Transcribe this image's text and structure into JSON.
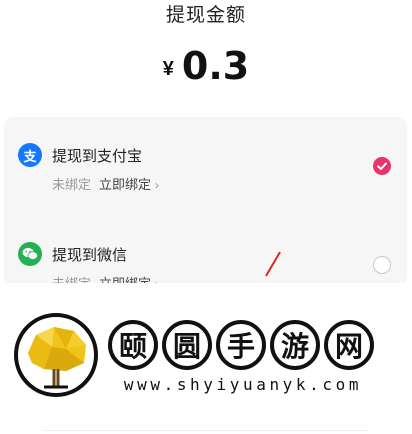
{
  "header": {
    "title": "提现金额"
  },
  "amount": {
    "currency": "¥",
    "value": "0.3"
  },
  "options": [
    {
      "name": "提现到支付宝",
      "status": "未绑定",
      "action": "立即绑定",
      "arrow": "›",
      "selected": true,
      "icon": "alipay-icon",
      "icon_color": "#1677ff",
      "icon_glyph": "支"
    },
    {
      "name": "提现到微信",
      "status": "未绑定",
      "action": "立即绑定",
      "arrow": "›",
      "selected": false,
      "icon": "wechat-icon",
      "icon_color": "#22b153"
    }
  ],
  "accent_color": "#e8336d",
  "watermark": {
    "chars": [
      "颐",
      "圆",
      "手",
      "游",
      "网"
    ],
    "url": "www.shyiyuanyk.com"
  }
}
